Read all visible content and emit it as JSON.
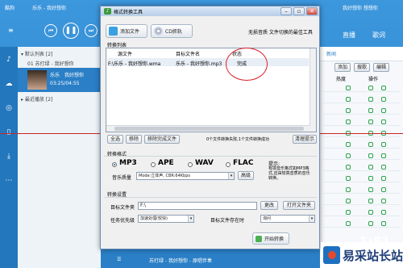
{
  "player": {
    "app_title": "酷狗",
    "song": "乐乐 - 我好想你",
    "user": "我好想你 想想你",
    "tab_live": "直播",
    "tab_lyrics": "歌词",
    "playlist_default": "默认列表",
    "playlist_default_count": "[2]",
    "item1": "01 苏打绿 - 我好想你",
    "item2_artist": "乐乐",
    "item2_title": "我好想你",
    "item2_time": "03:25/04:55",
    "recent": "最近播放",
    "recent_count": "[2]",
    "right_header": "新闻",
    "right_add": "添加",
    "right_search": "搜歌",
    "right_edit": "编辑",
    "right_hot": "热度",
    "right_ops": "操作",
    "bottom_now": "苏打绿 - 我好想你 - 原唱伴奏",
    "bottom_big": "1:51"
  },
  "dialog": {
    "title": "格式转换工具",
    "add_file": "添加文件",
    "cd_rip": "CD抓轨",
    "slogan": "无损音质 文件切换的最佳工具",
    "list_label": "转换列表",
    "col_source": "源文件",
    "col_target": "目标文件名",
    "col_status": "状态",
    "rows": [
      {
        "source": "F:\\乐乐 - 我好想你.wma",
        "target": "乐乐 - 我好想你.mp3",
        "status": "完成"
      }
    ],
    "btn_select_all": "全选",
    "btn_remove": "移除",
    "btn_remove_done": "移除完成文件",
    "progress_text": "0个文件转换失败,1个文件转换成功",
    "btn_clear": "清理提示",
    "format_label": "转换格式",
    "formats": [
      "MP3",
      "APE",
      "WAV",
      "FLAC"
    ],
    "selected_format": "MP3",
    "quality_label": "音乐质量",
    "quality_value": "Mode:立体声, CBR:64Kbps",
    "btn_advanced": "高级",
    "tip_title": "提示:",
    "tip_text": "有损音乐格式如MP3格式,应由较高音质的音乐转换。",
    "settings_label": "转换设置",
    "target_folder_label": "目标文件夹",
    "target_folder_value": "F:\\",
    "btn_change": "更改",
    "btn_open_folder": "打开文件夹",
    "priority_label": "任务优先级",
    "priority_value": "加速处理(较快)",
    "exists_label": "目标文件存在时",
    "exists_value": "询问",
    "btn_start": "开始转换"
  },
  "watermark": {
    "text": "易采站长站"
  },
  "colors": {
    "player_blue": "#2a7fc6",
    "annotation_red": "#d9222a",
    "dialog_bg": "#f0f0f0"
  }
}
